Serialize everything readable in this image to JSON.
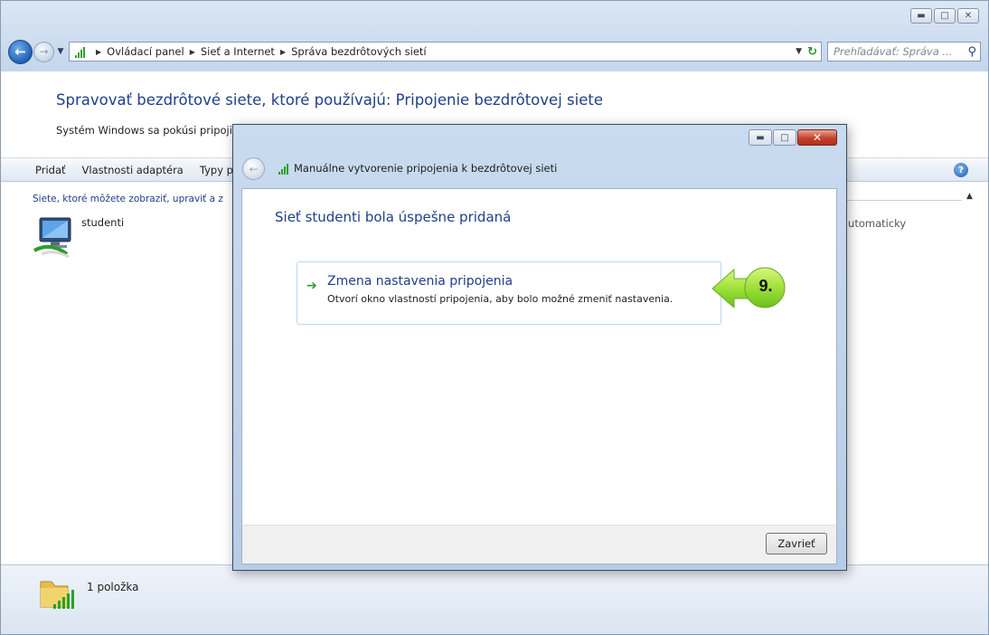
{
  "window": {
    "caption_buttons": [
      "minimize-icon",
      "maximize-icon",
      "close-icon"
    ]
  },
  "address_bar": {
    "breadcrumbs": [
      "Ovládací panel",
      "Sieť a Internet",
      "Správa bezdrôtových sietí"
    ],
    "search_placeholder": "Prehľadávať: Správa ..."
  },
  "main": {
    "title": "Spravovať bezdrôtové siete, ktoré používajú: Pripojenie bezdrôtovej siete",
    "description": "Systém Windows sa pokúsi pripojiť",
    "toolbar": [
      "Pridať",
      "Vlastnosti adaptéra",
      "Typy p"
    ],
    "list_header": "Siete, ktoré môžete zobraziť, upraviť a z",
    "networks": [
      {
        "name": "studenti",
        "mode": "automaticky"
      }
    ]
  },
  "status_bar": {
    "count_text": "1 položka"
  },
  "dialog": {
    "title": "Manuálne vytvorenie pripojenia k bezdrôtovej sieti",
    "heading": "Sieť studenti bola úspešne pridaná",
    "task": {
      "title": "Zmena nastavenia pripojenia",
      "description": "Otvorí okno vlastností pripojenia, aby bolo možné zmeniť nastavenia."
    },
    "close_label": "Zavrieť"
  },
  "callout": {
    "label": "9.",
    "color": "#9ee03a"
  }
}
